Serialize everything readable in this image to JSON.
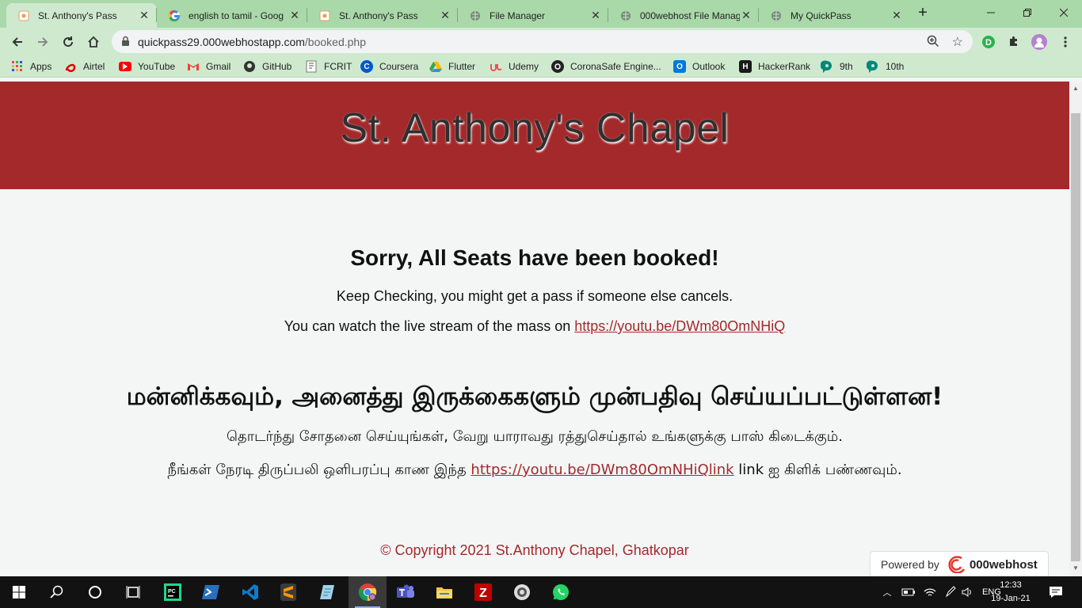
{
  "browser": {
    "tabs": [
      {
        "title": "St. Anthony's Pass",
        "active": true,
        "favicon": "page-icon"
      },
      {
        "title": "english to tamil - Goog",
        "active": false,
        "favicon": "google-icon"
      },
      {
        "title": "St. Anthony's Pass",
        "active": false,
        "favicon": "page-icon"
      },
      {
        "title": "File Manager",
        "active": false,
        "favicon": "globe-icon"
      },
      {
        "title": "000webhost File Manag",
        "active": false,
        "favicon": "globe-icon"
      },
      {
        "title": "My QuickPass",
        "active": false,
        "favicon": "globe-icon"
      }
    ],
    "url_host": "quickpass29.000webhostapp.com",
    "url_path": "/booked.php",
    "bookmarks": [
      {
        "label": "Apps",
        "icon": "apps-grid-icon"
      },
      {
        "label": "Airtel",
        "icon": "airtel-icon"
      },
      {
        "label": "YouTube",
        "icon": "youtube-icon"
      },
      {
        "label": "Gmail",
        "icon": "gmail-icon"
      },
      {
        "label": "GitHub",
        "icon": "github-icon"
      },
      {
        "label": "FCRIT",
        "icon": "fcrit-icon"
      },
      {
        "label": "Coursera",
        "icon": "coursera-icon"
      },
      {
        "label": "Flutter",
        "icon": "drive-icon"
      },
      {
        "label": "Udemy",
        "icon": "udemy-icon"
      },
      {
        "label": "CoronaSafe Engine...",
        "icon": "coronasafe-icon"
      },
      {
        "label": "Outlook",
        "icon": "outlook-icon"
      },
      {
        "label": "HackerRank",
        "icon": "hackerrank-icon"
      },
      {
        "label": "9th",
        "icon": "meet-icon"
      },
      {
        "label": "10th",
        "icon": "meet-icon"
      }
    ]
  },
  "page": {
    "banner_title": "St. Anthony's Chapel",
    "heading_en": "Sorry, All Seats have been booked!",
    "para1": "Keep Checking, you might get a pass if someone else cancels.",
    "para2_prefix": "You can watch the live stream of the mass on ",
    "stream_link": "https://youtu.be/DWm80OmNHiQ",
    "heading_ta": "மன்னிக்கவும், அனைத்து இருக்கைகளும் முன்பதிவு செய்யப்பட்டுள்ளன!",
    "para3_ta": "தொடர்ந்து சோதனை செய்யுங்கள், வேறு யாராவது ரத்துசெய்தால் உங்களுக்கு பாஸ் கிடைக்கும்.",
    "para4_prefix_ta": "நீங்கள் நேரடி திருப்பலி ஒளிபரப்பு காண இந்த ",
    "para4_link_ta": "https://youtu.be/DWm80OmNHiQlink",
    "para4_suffix_ta": " link ஐ கிளிக் பண்ணவும்.",
    "footer": "© Copyright 2021 St.Anthony Chapel, Ghatkopar",
    "powered_by": "Powered by",
    "powered_brand": "000webhost"
  },
  "taskbar": {
    "language": "ENG",
    "time": "12:33",
    "date": "19-Jan-21"
  },
  "colors": {
    "banner": "#a4292b",
    "chrome_frame": "#a9d8a9",
    "page_bg": "#f4f6f6",
    "link": "#a4292b"
  }
}
